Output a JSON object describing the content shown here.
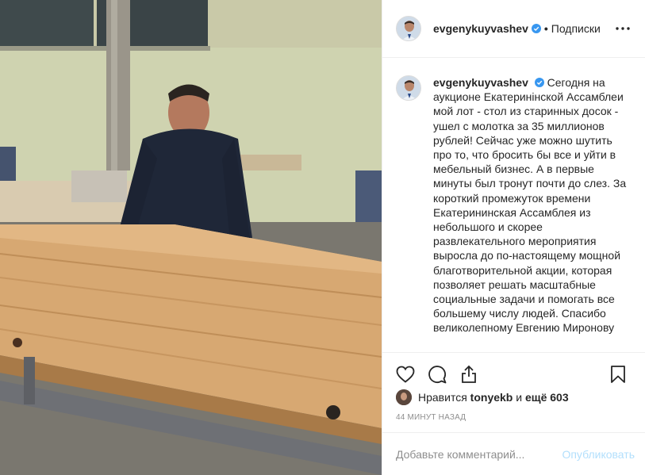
{
  "post": {
    "username": "evgenykuyvashev",
    "separator": "•",
    "follow_status": "Подписки",
    "caption": "Сегодня на аукционе Екатеринінской Ассамблеи мой лот - стол из старинных досок - ушел с молотка за 35 миллионов рублей! Сейчас уже можно шутить про то, что бросить бы все и уйти в мебельный бизнес. А в первые минуты был тронут почти до слез. За короткий промежуток времени Екатерининская Ассамблея из небольшого и скорее развлекательного мероприятия выросла до по-настоящему мощной благотворительной акции, которая позволяет решать масштабные социальные задачи и помогать все большему числу людей. Спасибо великолепному Евгению Миронову",
    "likes_prefix": "Нравится",
    "likes_user": "tonyekb",
    "likes_and": "и",
    "likes_more": "ещё 603",
    "time": "44 минут назад",
    "comment_placeholder": "Добавьте комментарий...",
    "publish_label": "Опубликовать"
  },
  "colors": {
    "verified": "#3897f0",
    "publish_disabled": "#b2dffc",
    "muted": "#8e8e8e"
  },
  "icons": [
    "more-options-icon",
    "verified-icon",
    "heart-icon",
    "comment-icon",
    "share-icon",
    "bookmark-icon"
  ]
}
